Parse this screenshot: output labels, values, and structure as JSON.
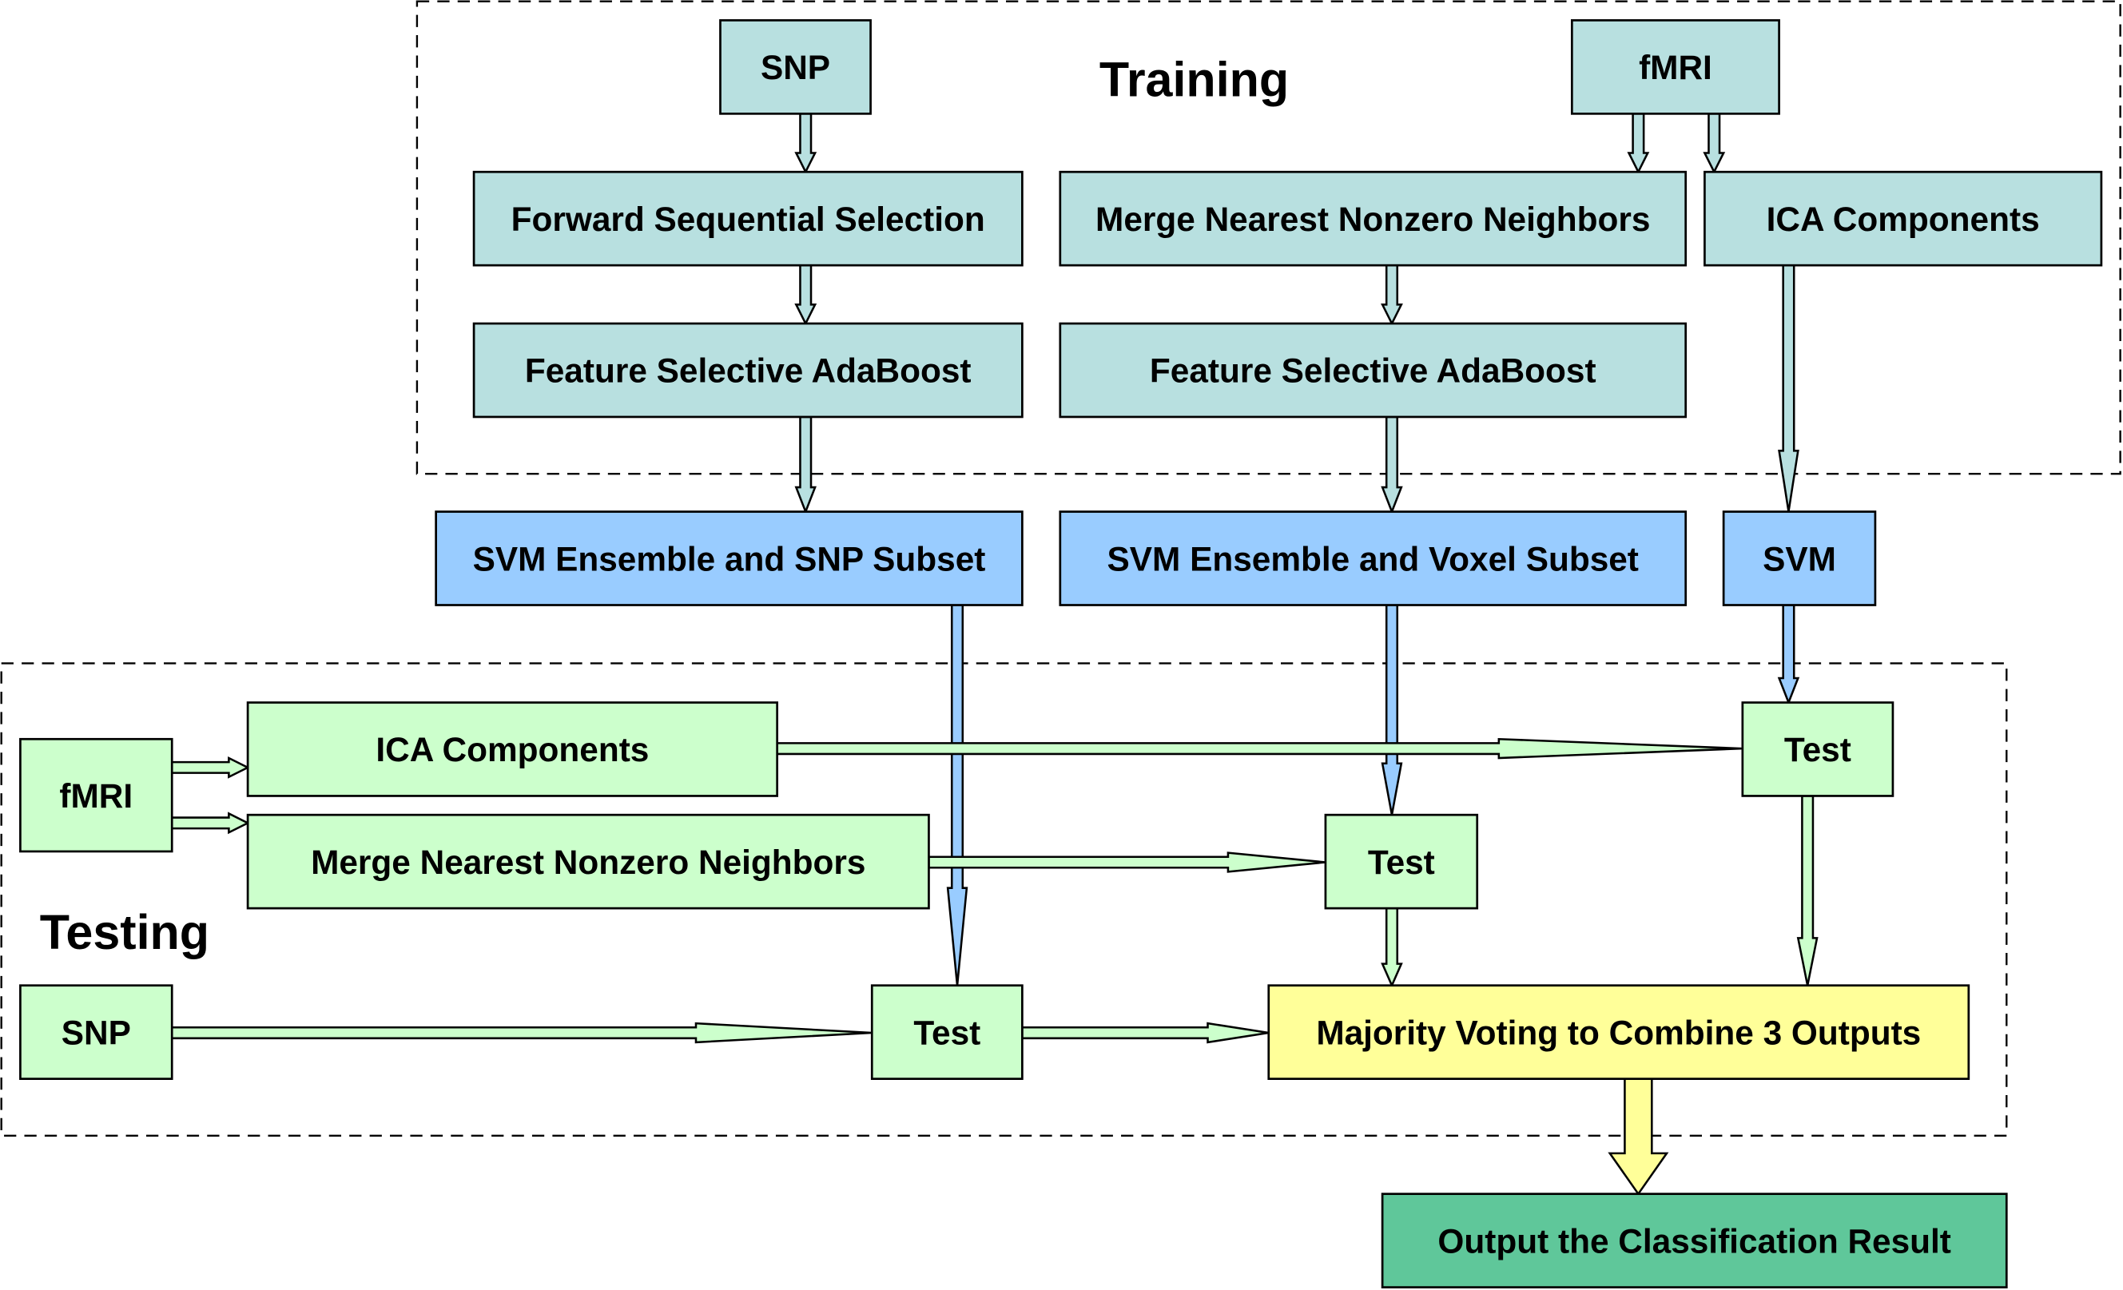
{
  "colors": {
    "teal": "#b8e0e0",
    "blue": "#99ccff",
    "green": "#ccffcc",
    "yellow": "#ffff99",
    "output": "#5fc79a"
  },
  "sections": {
    "training": "Training",
    "testing": "Testing"
  },
  "nodes": {
    "snp_train": "SNP",
    "fmri_train": "fMRI",
    "fss": "Forward Sequential Selection",
    "mnnn_train": "Merge Nearest Nonzero Neighbors",
    "ica_train": "ICA Components",
    "fsa_snp": "Feature Selective AdaBoost",
    "fsa_fmri": "Feature Selective AdaBoost",
    "svm_snp": "SVM Ensemble and SNP Subset",
    "svm_voxel": "SVM Ensemble and Voxel Subset",
    "svm": "SVM",
    "fmri_test": "fMRI",
    "ica_test": "ICA Components",
    "mnnn_test": "Merge Nearest Nonzero Neighbors",
    "snp_test": "SNP",
    "test1": "Test",
    "test2": "Test",
    "test3": "Test",
    "majority": "Majority Voting to Combine 3 Outputs",
    "output": "Output the Classification Result"
  },
  "edges": [
    {
      "from": "snp_train",
      "to": "fss"
    },
    {
      "from": "fss",
      "to": "fsa_snp"
    },
    {
      "from": "fsa_snp",
      "to": "svm_snp"
    },
    {
      "from": "fmri_train",
      "to": "mnnn_train"
    },
    {
      "from": "fmri_train",
      "to": "ica_train"
    },
    {
      "from": "mnnn_train",
      "to": "fsa_fmri"
    },
    {
      "from": "fsa_fmri",
      "to": "svm_voxel"
    },
    {
      "from": "ica_train",
      "to": "svm"
    },
    {
      "from": "svm_snp",
      "to": "test1"
    },
    {
      "from": "svm_voxel",
      "to": "test2"
    },
    {
      "from": "svm",
      "to": "test3"
    },
    {
      "from": "fmri_test",
      "to": "ica_test"
    },
    {
      "from": "fmri_test",
      "to": "mnnn_test"
    },
    {
      "from": "ica_test",
      "to": "test3"
    },
    {
      "from": "mnnn_test",
      "to": "test2"
    },
    {
      "from": "snp_test",
      "to": "test1"
    },
    {
      "from": "test1",
      "to": "majority"
    },
    {
      "from": "test2",
      "to": "majority"
    },
    {
      "from": "test3",
      "to": "majority"
    },
    {
      "from": "majority",
      "to": "output"
    }
  ]
}
